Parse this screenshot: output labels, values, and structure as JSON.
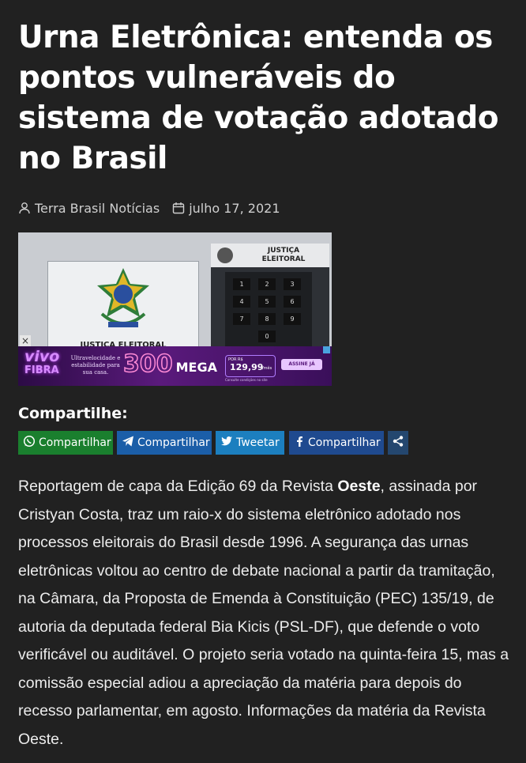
{
  "article": {
    "title": "Urna Eletrônica: entenda os pontos vulneráveis do sistema de votação adotado no Brasil",
    "author": "Terra Brasil Notícias",
    "date": "julho 17, 2021"
  },
  "hero": {
    "panel_label_line1": "JUSTIÇA",
    "panel_label_line2": "ELEITORAL",
    "screen_label": "JUSTIÇA ELEITORAL",
    "keys": [
      "1",
      "2",
      "3",
      "4",
      "5",
      "6",
      "7",
      "8",
      "9",
      "0"
    ],
    "ad": {
      "close_label": "×",
      "brand_line1": "vivo",
      "brand_line2": "FIBRA",
      "tagline": "Ultravelocidade e estabilidade para sua casa.",
      "speed": "300",
      "speed_unit": "MEGA",
      "price_prefix": "POR R$",
      "price": "129,99",
      "price_suffix": "/mês",
      "cta": "ASSINE JÁ",
      "fineprint": "Consulte condições no site"
    }
  },
  "share": {
    "title": "Compartilhe:",
    "buttons": [
      {
        "label": "Compartilhar",
        "color": "#1a7f2e"
      },
      {
        "label": "Compartilhar",
        "color": "#1b5ea8"
      },
      {
        "label": "Tweetar",
        "color": "#1c7fbf"
      },
      {
        "label": "Compartilhar",
        "color": "#1f4a8f"
      }
    ],
    "more_color": "#24476f"
  },
  "body": {
    "before_bold": "Reportagem de capa da Edição 69 da Revista ",
    "bold": "Oeste",
    "after_bold": ", assinada por Cristyan Costa, traz um raio-x do sistema eletrônico adotado nos processos eleitorais do Brasil desde 1996. A segurança das urnas eletrônicas voltou ao centro de debate nacional a partir da tramitação, na Câmara, da Proposta de Emenda à Constituição (PEC) 135/19, de autoria da deputada federal Bia Kicis (PSL-DF), que defende o voto verificável ou auditável. O projeto seria votado na quinta-feira 15, mas a comissão especial adiou a apreciação da matéria para depois do recesso parlamentar, em agosto. Informações da matéria da Revista Oeste."
  }
}
